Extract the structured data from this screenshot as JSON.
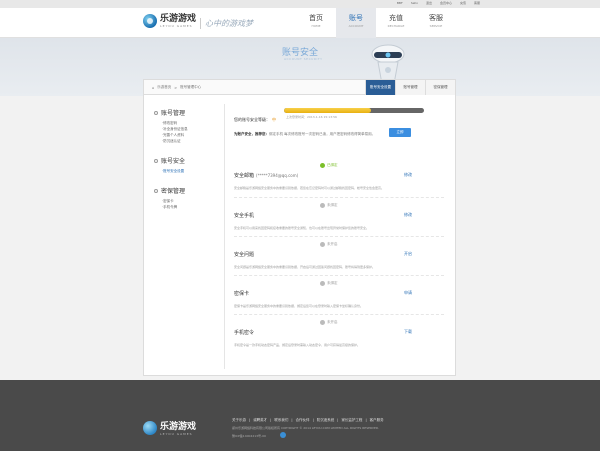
{
  "top_links": [
    "BBF",
    "hello",
    "退出",
    "会员中心",
    "充值",
    "客服"
  ],
  "brand": {
    "name": "乐游游戏",
    "sub": "LEYOU GAMES",
    "slogan": "心中的游戏梦"
  },
  "nav": [
    {
      "cn": "首页",
      "en": "HOME"
    },
    {
      "cn": "账号",
      "en": "ACCOUNT"
    },
    {
      "cn": "充值",
      "en": "RECHARGE"
    },
    {
      "cn": "客服",
      "en": "SERVICE"
    }
  ],
  "banner": {
    "title": "账号安全",
    "subtitle": "ACCOUNT SECURITY"
  },
  "breadcrumb": {
    "home": "乐游首页",
    "sep": ">",
    "current": "账号管理中心"
  },
  "tabs": [
    "账号安全设置",
    "账号管理",
    "密保管理"
  ],
  "sidebar": [
    {
      "head": "账号管理",
      "links": [
        "·修改密码",
        "·补全身份证信息",
        "·完善个人资料",
        "·防沉迷认证"
      ]
    },
    {
      "head": "账号安全",
      "links": [
        "·账号安全设置"
      ]
    },
    {
      "head": "密保管理",
      "links": [
        "·密保卡",
        "·手机令牌"
      ]
    }
  ],
  "security": {
    "label": "您的账号安全等级：",
    "level": "中",
    "progress": 0.62,
    "last_login": "上次登录时间：2013-1-16 15:13:56",
    "tip_label": "为账户安全，推荐您：",
    "tip_text": "绑定手机 每次修改账号一次密码已读，用户把密码修改得简单易用。",
    "tip_button": "立即"
  },
  "items": [
    {
      "title": "安全邮箱",
      "value": "(*****7394@qq.com)",
      "status": "已绑定",
      "ok": true,
      "desc": "安全邮箱是乐游网络安全服务中的重要识别依据，若您在忘记密码时可以通过邮箱找回密码，帐号安全性会更高。",
      "action": "修改"
    },
    {
      "title": "安全手机",
      "value": "",
      "status": "未绑定",
      "ok": false,
      "desc": "安全手机可以用来找回密码和接收重要的账号安全通知，也可以在账号出现异常时保护您的账号安全。",
      "action": "修改"
    },
    {
      "title": "安全问题",
      "value": "",
      "status": "未开启",
      "ok": false,
      "desc": "安全问题是乐游网络安全服务中的重要识别依据，开启后可通过回答问题找回密码，账号将得到更多保护。",
      "action": "开启"
    },
    {
      "title": "密保卡",
      "value": "",
      "status": "未绑定",
      "ok": false,
      "desc": "密保卡是乐游网络安全服务中的重要识别依据，绑定后您可以在登录时输入密保卡坐标确认身份。",
      "action": "申请"
    },
    {
      "title": "手机密令",
      "value": "",
      "status": "未开启",
      "ok": false,
      "desc": "手机密令是一款手机动态密码产品，绑定后登录时需输入动态密令，用户可获得最高级的保护。",
      "action": "下载"
    }
  ],
  "footer": {
    "links": [
      "关于乐游",
      "|",
      "诚聘英才",
      "|",
      "联系我们",
      "|",
      "合作伙伴",
      "|",
      "防沉迷系统",
      "|",
      "家长监护工程",
      "|",
      "客户服务"
    ],
    "copy": "郑州乐游网络科技有限公司版权所有  COPYRIGHT © 2014 LEYOU.COM LIMITED ALL RIGHTS RESERVED.",
    "icp": "豫ICP备14004213号-00"
  }
}
